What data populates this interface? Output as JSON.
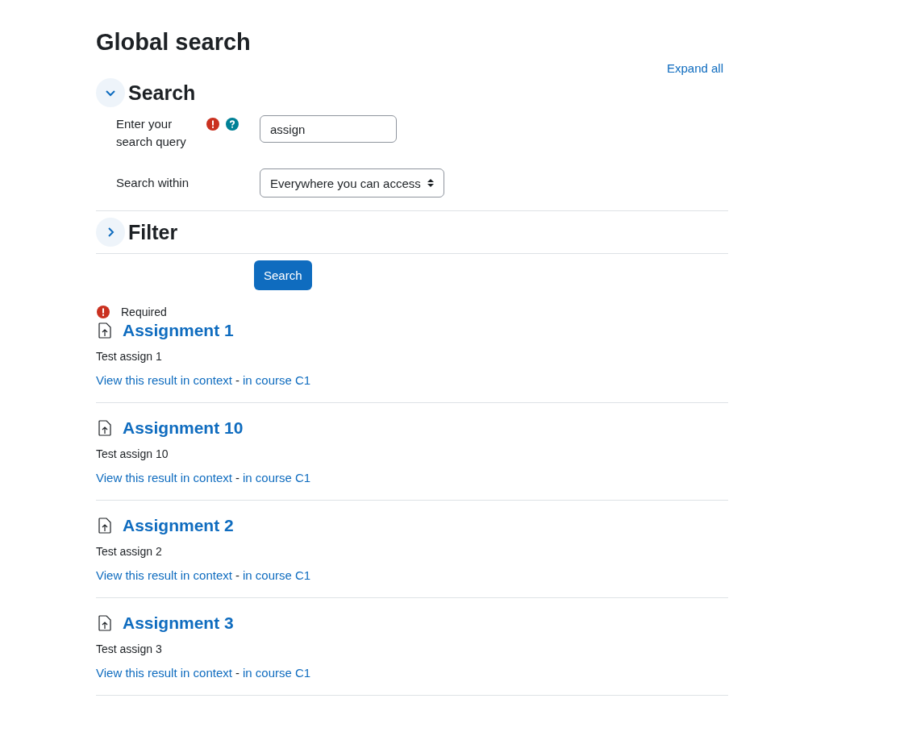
{
  "page_title": "Global search",
  "expand_all": "Expand all",
  "sections": [
    {
      "title": "Search",
      "expanded": true
    },
    {
      "title": "Filter",
      "expanded": false
    }
  ],
  "query": {
    "label": "Enter your search query",
    "value": "assign"
  },
  "within": {
    "label": "Search within",
    "value": "Everywhere you can access"
  },
  "search_button": "Search",
  "required_note": "Required",
  "results": [
    {
      "title": "Assignment 1",
      "description": "Test assign 1",
      "context_link": "View this result in context",
      "separator": "-",
      "course_link": "in course C1"
    },
    {
      "title": "Assignment 10",
      "description": "Test assign 10",
      "context_link": "View this result in context",
      "separator": "-",
      "course_link": "in course C1"
    },
    {
      "title": "Assignment 2",
      "description": "Test assign 2",
      "context_link": "View this result in context",
      "separator": "-",
      "course_link": "in course C1"
    },
    {
      "title": "Assignment 3",
      "description": "Test assign 3",
      "context_link": "View this result in context",
      "separator": "-",
      "course_link": "in course C1"
    }
  ]
}
